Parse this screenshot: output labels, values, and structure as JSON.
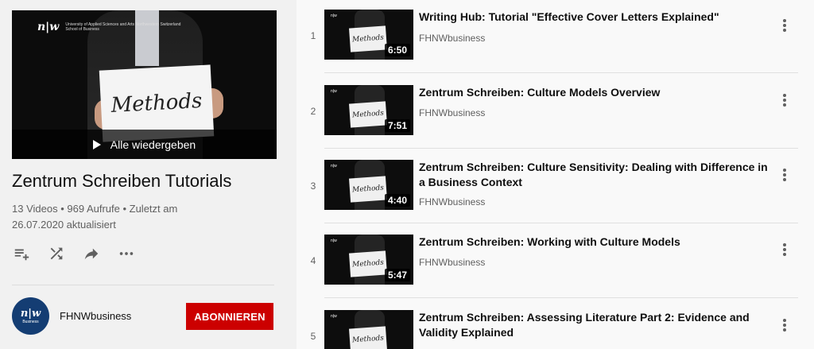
{
  "playlist": {
    "title": "Zentrum Schreiben Tutorials",
    "meta_line1": "13 Videos • 969 Aufrufe • Zuletzt am",
    "meta_line2": "26.07.2020 aktualisiert",
    "play_all_label": "Alle wiedergeben",
    "hero_sign_text": "Methods",
    "hero_logo_mark": "n|w",
    "hero_logo_line1": "University of Applied Sciences and Arts Northwestern Switzerland",
    "hero_logo_line2": "School of Business"
  },
  "actions": [
    {
      "icon": "add-to-queue-icon"
    },
    {
      "icon": "shuffle-icon"
    },
    {
      "icon": "share-icon"
    },
    {
      "icon": "more-horizontal-icon"
    }
  ],
  "owner": {
    "name": "FHNWbusiness",
    "avatar_mark": "n|w",
    "avatar_sub": "Business",
    "subscribe_label": "ABONNIEREN"
  },
  "colors": {
    "accent": "#cc0000",
    "avatar": "#143d73"
  },
  "videos": [
    {
      "index": "1",
      "title": "Writing Hub: Tutorial \"Effective Cover Letters Explained\"",
      "channel": "FHNWbusiness",
      "duration": "6:50",
      "sign": "Methods"
    },
    {
      "index": "2",
      "title": "Zentrum Schreiben: Culture Models Overview",
      "channel": "FHNWbusiness",
      "duration": "7:51",
      "sign": "Methods"
    },
    {
      "index": "3",
      "title": "Zentrum Schreiben: Culture Sensitivity: Dealing with Difference in a Business Context",
      "channel": "FHNWbusiness",
      "duration": "4:40",
      "sign": "Methods"
    },
    {
      "index": "4",
      "title": "Zentrum Schreiben: Working with Culture Models",
      "channel": "FHNWbusiness",
      "duration": "5:47",
      "sign": "Methods"
    },
    {
      "index": "5",
      "title": "Zentrum Schreiben: Assessing Literature Part 2: Evidence and Validity Explained",
      "channel": "FHNWbusiness",
      "duration": "",
      "sign": "Methods"
    }
  ]
}
